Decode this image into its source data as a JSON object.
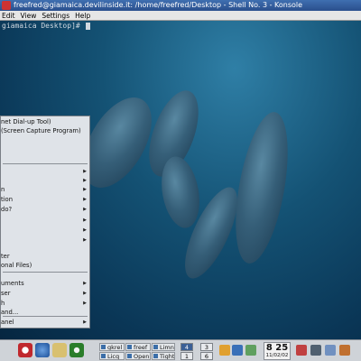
{
  "window": {
    "title": "freefred@giamaica.devilinside.it: /home/freefred/Desktop - Shell No. 3 - Konsole"
  },
  "menubar": {
    "items": [
      "Edit",
      "View",
      "Settings",
      "Help"
    ]
  },
  "terminal": {
    "prompt": "giamaica Desktop]# "
  },
  "kmenu": {
    "items": [
      {
        "label": "net Dial-up Tool)",
        "submenu": false
      },
      {
        "label": "(Screen Capture Program)",
        "submenu": false
      },
      {
        "label": "",
        "submenu": true
      },
      {
        "label": "",
        "submenu": true
      },
      {
        "label": "n",
        "submenu": true
      },
      {
        "label": "tion",
        "submenu": true
      },
      {
        "label": "do?",
        "submenu": true
      },
      {
        "label": "",
        "submenu": true
      },
      {
        "label": "",
        "submenu": true
      },
      {
        "label": "",
        "submenu": true
      },
      {
        "label": "ter",
        "submenu": false
      },
      {
        "label": "onal Files)",
        "submenu": false
      },
      {
        "label": "uments",
        "submenu": true
      },
      {
        "label": "ser",
        "submenu": true
      },
      {
        "label": "h",
        "submenu": true
      },
      {
        "label": "and...",
        "submenu": false
      },
      {
        "label": "anel",
        "submenu": true
      }
    ]
  },
  "taskbar": {
    "tasks": [
      "gkrel",
      "Licq",
      "freef",
      "Open",
      "Limn",
      "Tight"
    ],
    "pager": [
      "4",
      "3",
      "1",
      "6"
    ],
    "active_desktop": "4"
  },
  "clock": {
    "time": "8 25",
    "date": "11/02/02"
  }
}
